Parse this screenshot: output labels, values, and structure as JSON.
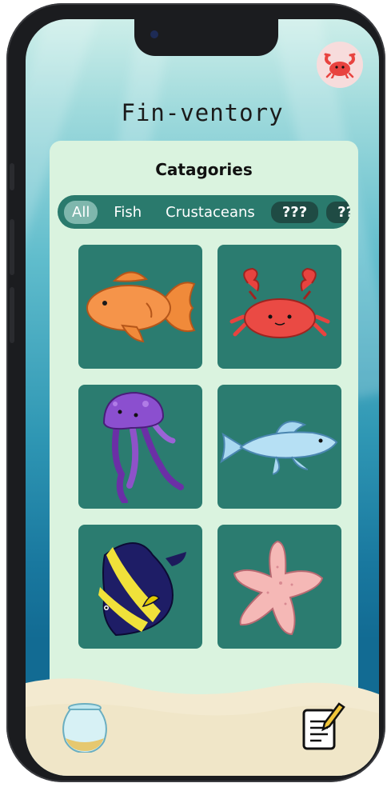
{
  "app": {
    "title": "Fin-ventory"
  },
  "header": {
    "profile_icon": "crab-icon"
  },
  "categories": {
    "heading": "Catagories",
    "filters": [
      {
        "label": "All",
        "state": "active"
      },
      {
        "label": "Fish",
        "state": "normal"
      },
      {
        "label": "Crustaceans",
        "state": "normal"
      },
      {
        "label": "???",
        "state": "locked"
      },
      {
        "label": "??",
        "state": "locked"
      }
    ]
  },
  "collection": {
    "items": [
      {
        "icon": "goldfish-icon"
      },
      {
        "icon": "crab-icon"
      },
      {
        "icon": "jellyfish-icon"
      },
      {
        "icon": "blue-fish-icon"
      },
      {
        "icon": "angelfish-icon"
      },
      {
        "icon": "starfish-icon"
      }
    ]
  },
  "bottom_bar": {
    "left_icon": "fishbowl-icon",
    "right_icon": "notepad-icon"
  },
  "colors": {
    "card_bg": "#daf3df",
    "tile_bg": "#2b7c70",
    "filter_bar": "#2a7a6d",
    "active_chip": "#7fb7ad",
    "locked_chip": "#1f4b44",
    "sand": "#f3ead0"
  }
}
